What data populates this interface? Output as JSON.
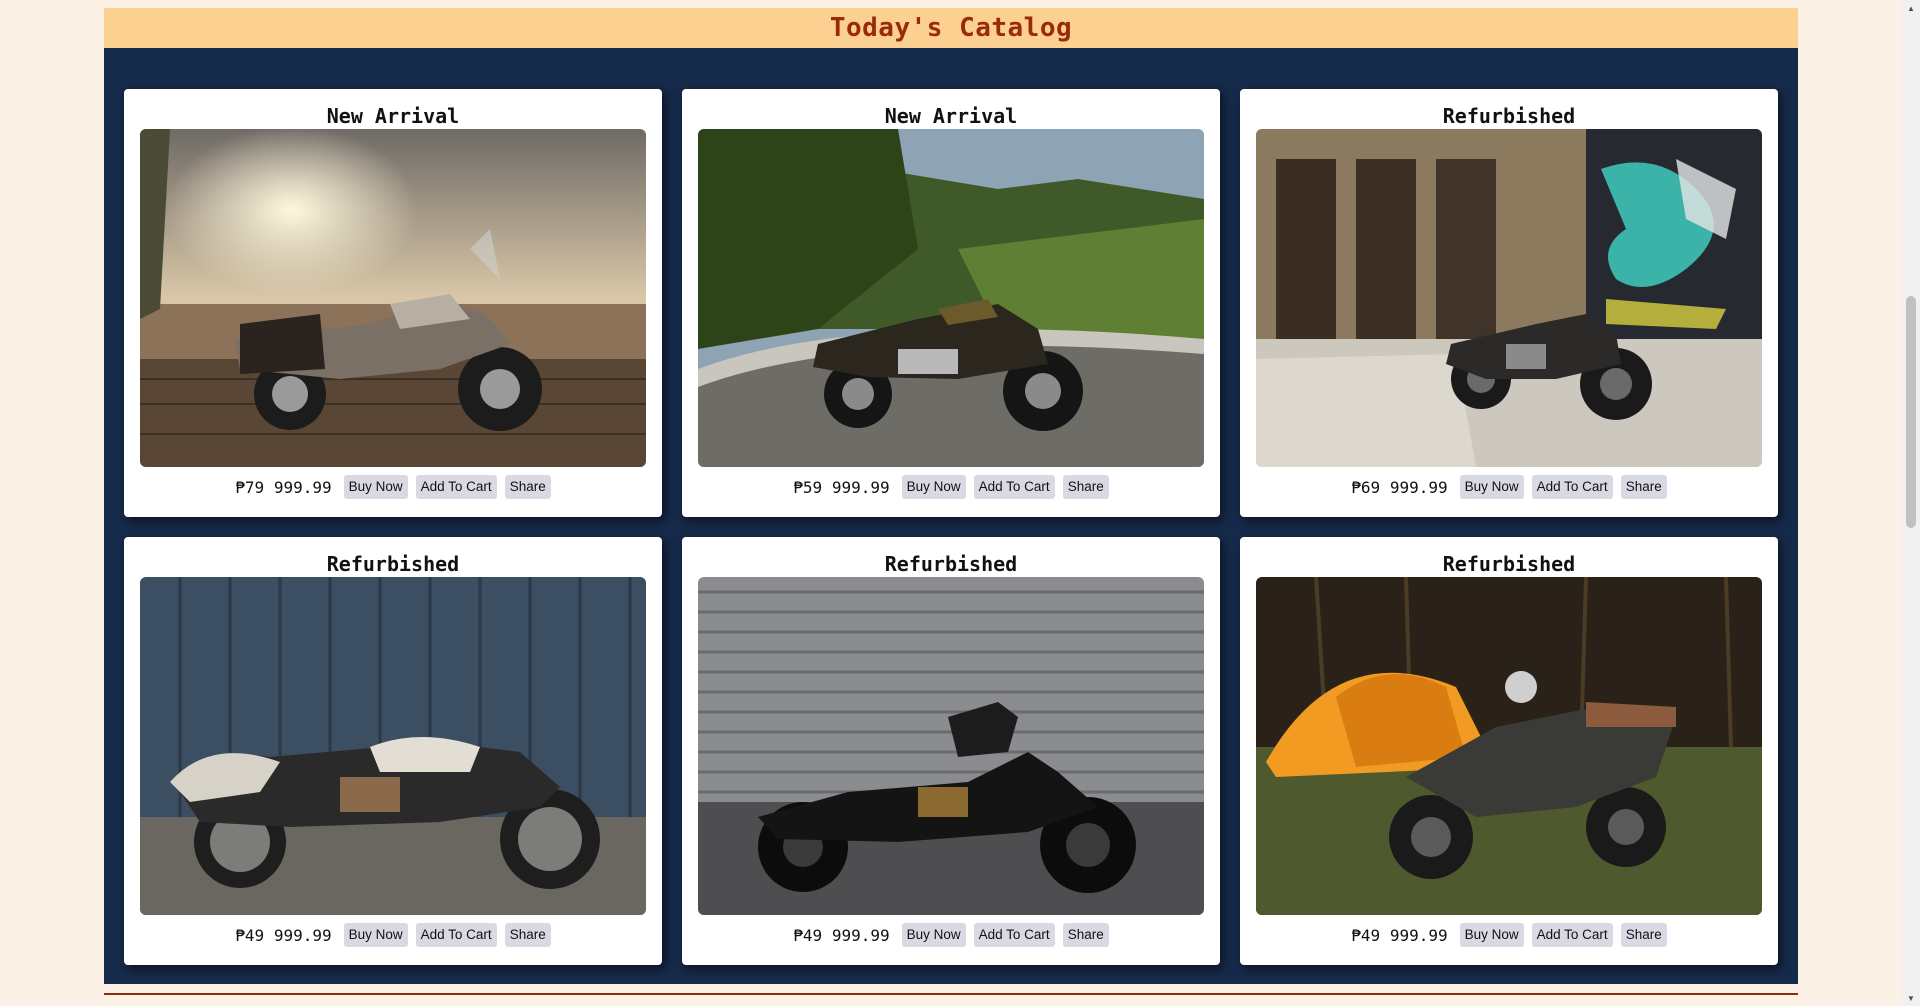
{
  "catalog": {
    "title": "Today's Catalog"
  },
  "buttons": {
    "buy": "Buy Now",
    "cart": "Add To Cart",
    "share": "Share"
  },
  "products": [
    {
      "tag": "New Arrival",
      "price": "₱79 999.99",
      "image_icon": "motorcycle-icon"
    },
    {
      "tag": "New Arrival",
      "price": "₱59 999.99",
      "image_icon": "motorcycle-icon"
    },
    {
      "tag": "Refurbished",
      "price": "₱69 999.99",
      "image_icon": "motorcycle-icon"
    },
    {
      "tag": "Refurbished",
      "price": "₱49 999.99",
      "image_icon": "motorcycle-icon"
    },
    {
      "tag": "Refurbished",
      "price": "₱49 999.99",
      "image_icon": "motorcycle-icon"
    },
    {
      "tag": "Refurbished",
      "price": "₱49 999.99",
      "image_icon": "motorcycle-icon"
    }
  ],
  "colors": {
    "page_background": "#fbf1e6",
    "catalog_background": "#162a4a",
    "header_background": "#fcd091",
    "title_color": "#9a2a0c",
    "button_background": "#d9d9e3"
  }
}
